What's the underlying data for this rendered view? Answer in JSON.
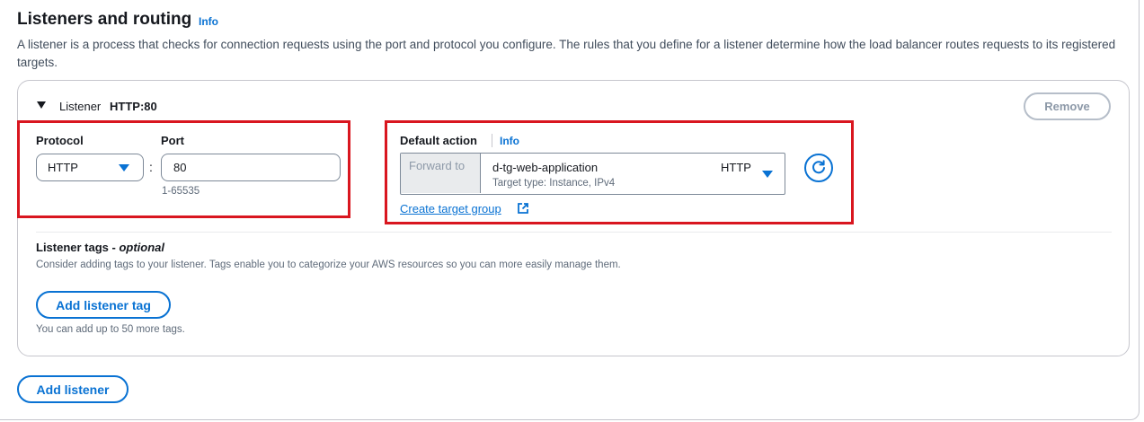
{
  "section": {
    "title": "Listeners and routing",
    "info_label": "Info",
    "description": "A listener is a process that checks for connection requests using the port and protocol you configure. The rules that you define for a listener determine how the load balancer routes requests to its registered targets."
  },
  "listener": {
    "label": "Listener",
    "value": "HTTP:80",
    "remove_label": "Remove",
    "protocol": {
      "label": "Protocol",
      "value": "HTTP"
    },
    "port": {
      "label": "Port",
      "value": "80",
      "hint": "1-65535"
    },
    "default_action": {
      "label": "Default action",
      "info_label": "Info",
      "prefix": "Forward to",
      "target_name": "d-tg-web-application",
      "target_detail": "Target type: Instance, IPv4",
      "target_protocol": "HTTP",
      "create_link": "Create target group"
    },
    "tags": {
      "title": "Listener tags - ",
      "title_optional": "optional",
      "description": "Consider adding tags to your listener. Tags enable you to categorize your AWS resources so you can more easily manage them.",
      "add_label": "Add listener tag",
      "hint": "You can add up to 50 more tags."
    }
  },
  "add_listener_label": "Add listener",
  "colors": {
    "accent": "#0972d3",
    "highlight": "#d9161f",
    "disabled": "#8d99a8"
  },
  "icons": [
    "caret-down-icon",
    "dropdown-caret-icon",
    "refresh-icon",
    "external-link-icon"
  ]
}
